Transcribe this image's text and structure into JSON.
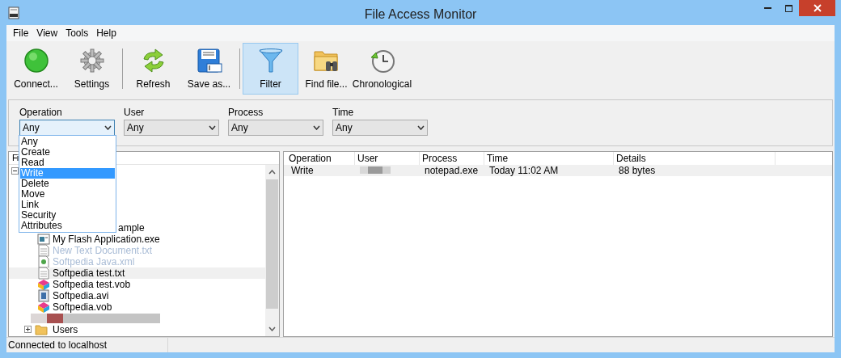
{
  "window": {
    "title": "File Access Monitor"
  },
  "menu": [
    "File",
    "View",
    "Tools",
    "Help"
  ],
  "toolbar": [
    [
      {
        "label": "Connect...",
        "kind": "connect",
        "selected": false
      },
      {
        "label": "Settings",
        "kind": "settings",
        "selected": false
      }
    ],
    [
      {
        "label": "Refresh",
        "kind": "refresh",
        "selected": false
      },
      {
        "label": "Save as...",
        "kind": "save",
        "selected": false
      }
    ],
    [
      {
        "label": "Filter",
        "kind": "filter",
        "selected": true
      },
      {
        "label": "Find file...",
        "kind": "find",
        "selected": false
      },
      {
        "label": "Chronological",
        "kind": "clock",
        "selected": false
      }
    ]
  ],
  "filters": [
    {
      "label": "Operation",
      "value": "Any",
      "focused": true
    },
    {
      "label": "User",
      "value": "Any",
      "focused": false
    },
    {
      "label": "Process",
      "value": "Any",
      "focused": false
    },
    {
      "label": "Time",
      "value": "Any",
      "focused": false
    }
  ],
  "dropdown": {
    "items": [
      {
        "label": "Any",
        "selected": false
      },
      {
        "label": "Create",
        "selected": false
      },
      {
        "label": "Read",
        "selected": false
      },
      {
        "label": "Write",
        "selected": true
      },
      {
        "label": "Delete",
        "selected": false
      },
      {
        "label": "Move",
        "selected": false
      },
      {
        "label": "Link",
        "selected": false
      },
      {
        "label": "Security",
        "selected": false
      },
      {
        "label": "Attributes",
        "selected": false
      }
    ]
  },
  "tree": {
    "header": "Fi",
    "nodes": [
      {
        "expanded": true,
        "children": [
          {
            "expanded": true,
            "children": [
              {
                "label": "ample",
                "kind": "none",
                "dimmed": false,
                "selected": false
              },
              {
                "label": "My Flash Application.exe",
                "kind": "exe",
                "dimmed": false,
                "selected": false
              },
              {
                "label": "New Text Document.txt",
                "kind": "txt",
                "dimmed": true,
                "selected": false
              },
              {
                "label": "Softpedia Java.xml",
                "kind": "xml",
                "dimmed": true,
                "selected": false
              },
              {
                "label": "Softpedia test.txt",
                "kind": "txt",
                "dimmed": false,
                "selected": true
              },
              {
                "label": "Softpedia test.vob",
                "kind": "vob",
                "dimmed": false,
                "selected": false
              },
              {
                "label": "Softpedia.avi",
                "kind": "avi",
                "dimmed": false,
                "selected": false
              },
              {
                "label": "Softpedia.vob",
                "kind": "vob",
                "dimmed": false,
                "selected": false
              },
              {
                "kind": "redacted",
                "selected": false
              }
            ]
          },
          {
            "label": "Users",
            "kind": "folder",
            "expanded": false
          }
        ]
      }
    ]
  },
  "events": {
    "columns": [
      "Operation",
      "User",
      "Process",
      "Time",
      "Details"
    ],
    "rows": [
      {
        "operation": "Write",
        "user_redacted": true,
        "process": "notepad.exe",
        "time": "Today 11:02 AM",
        "details": "88 bytes",
        "selected": true
      }
    ]
  },
  "status_bar": "Connected to localhost"
}
